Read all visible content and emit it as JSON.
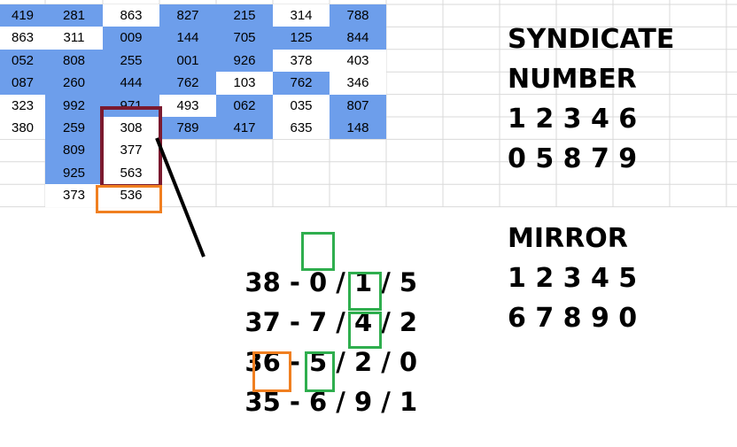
{
  "grid": {
    "rows": [
      [
        {
          "v": "419",
          "c": "blue"
        },
        {
          "v": "281",
          "c": "blue"
        },
        {
          "v": "863",
          "c": "white"
        },
        {
          "v": "827",
          "c": "blue"
        },
        {
          "v": "215",
          "c": "blue"
        },
        {
          "v": "314",
          "c": "white"
        },
        {
          "v": "788",
          "c": "blue"
        }
      ],
      [
        {
          "v": "863",
          "c": "white"
        },
        {
          "v": "311",
          "c": "white"
        },
        {
          "v": "009",
          "c": "blue"
        },
        {
          "v": "144",
          "c": "blue"
        },
        {
          "v": "705",
          "c": "blue"
        },
        {
          "v": "125",
          "c": "blue"
        },
        {
          "v": "844",
          "c": "blue"
        }
      ],
      [
        {
          "v": "052",
          "c": "blue"
        },
        {
          "v": "808",
          "c": "blue"
        },
        {
          "v": "255",
          "c": "blue"
        },
        {
          "v": "001",
          "c": "blue"
        },
        {
          "v": "926",
          "c": "blue"
        },
        {
          "v": "378",
          "c": "white"
        },
        {
          "v": "403",
          "c": "white"
        }
      ],
      [
        {
          "v": "087",
          "c": "blue"
        },
        {
          "v": "260",
          "c": "blue"
        },
        {
          "v": "444",
          "c": "blue"
        },
        {
          "v": "762",
          "c": "blue"
        },
        {
          "v": "103",
          "c": "white"
        },
        {
          "v": "762",
          "c": "blue"
        },
        {
          "v": "346",
          "c": "white"
        }
      ],
      [
        {
          "v": "323",
          "c": "white"
        },
        {
          "v": "992",
          "c": "blue"
        },
        {
          "v": "971",
          "c": "blue"
        },
        {
          "v": "493",
          "c": "white"
        },
        {
          "v": "062",
          "c": "blue"
        },
        {
          "v": "035",
          "c": "white"
        },
        {
          "v": "807",
          "c": "blue"
        }
      ],
      [
        {
          "v": "380",
          "c": "white"
        },
        {
          "v": "259",
          "c": "blue"
        },
        {
          "v": "308",
          "c": "white"
        },
        {
          "v": "789",
          "c": "blue"
        },
        {
          "v": "417",
          "c": "blue"
        },
        {
          "v": "635",
          "c": "white"
        },
        {
          "v": "148",
          "c": "blue"
        }
      ],
      [
        null,
        {
          "v": "809",
          "c": "blue"
        },
        {
          "v": "377",
          "c": "white"
        },
        null,
        null,
        null,
        null
      ],
      [
        null,
        {
          "v": "925",
          "c": "blue"
        },
        {
          "v": "563",
          "c": "white"
        },
        null,
        null,
        null,
        null
      ],
      [
        null,
        {
          "v": "373",
          "c": "white"
        },
        {
          "v": "536",
          "c": "white"
        },
        null,
        null,
        null,
        null
      ]
    ]
  },
  "calculations": [
    {
      "lead": "38 - 0 / ",
      "d1": "1",
      "mid": " / 5",
      "d2": "",
      "tail": ""
    },
    {
      "lead": "37 - 7 / 4 / ",
      "d1": "2",
      "mid": "",
      "d2": "",
      "tail": ""
    },
    {
      "lead": "36 - 5 / 2 / ",
      "d1": "0",
      "mid": "",
      "d2": "",
      "tail": ""
    },
    {
      "lead": "35 - ",
      "d1": "6",
      "mid": " / ",
      "d2": "9",
      "tail": " / 1"
    }
  ],
  "syndicate": {
    "title_line1": "SYNDICATE",
    "title_line2": "NUMBER",
    "row1": "1 2 3 4 6",
    "row2": "0 5 8 7 9"
  },
  "mirror": {
    "title": "MIRROR",
    "row1": "1 2 3 4 5",
    "row2": "6 7 8 9 0"
  },
  "colors": {
    "cell_blue": "#6d9eeb",
    "highlight_red": "#7b1a2f",
    "highlight_orange": "#f07f20",
    "box_green": "#2fae4e"
  }
}
